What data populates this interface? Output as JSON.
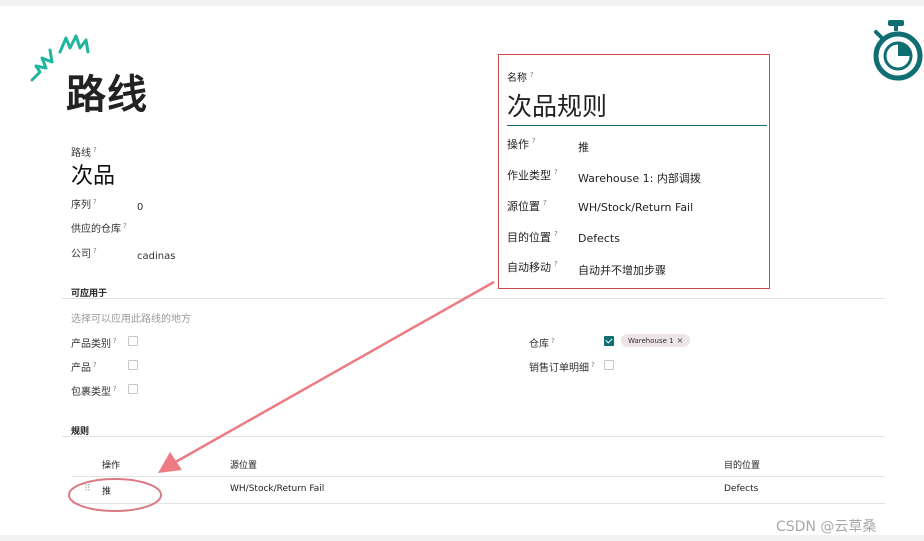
{
  "page_title": "路线",
  "route_field_label": "路线",
  "route_name": "次品",
  "fields": [
    {
      "label": "序列",
      "value": "0"
    },
    {
      "label": "供应的仓库",
      "value": ""
    },
    {
      "label": "公司",
      "value": "cadinas"
    }
  ],
  "applicable": {
    "heading": "可应用于",
    "placeholder": "选择可以应用此路线的地方",
    "left_options": [
      {
        "label": "产品类别",
        "checked": false
      },
      {
        "label": "产品",
        "checked": false
      },
      {
        "label": "包裹类型",
        "checked": false
      }
    ],
    "warehouse_label": "仓库",
    "warehouse_checked": true,
    "warehouse_tag": "Warehouse 1",
    "warehouse_tag_remove": "×",
    "sale_line_label": "销售订单明细",
    "sale_line_checked": false
  },
  "rules": {
    "heading": "规则",
    "columns": [
      "操作",
      "源位置",
      "目的位置"
    ],
    "rows": [
      {
        "handle": "⠿",
        "action": "推",
        "source": "WH/Stock/Return Fail",
        "dest": "Defects"
      }
    ]
  },
  "callout": {
    "name_label": "名称",
    "name_value": "次品规则",
    "rows": [
      {
        "label": "操作",
        "value": "推"
      },
      {
        "label": "作业类型",
        "value": "Warehouse 1: 内部调拨"
      },
      {
        "label": "源位置",
        "value": "WH/Stock/Return Fail"
      },
      {
        "label": "目的位置",
        "value": "Defects"
      },
      {
        "label": "自动移动",
        "value": "自动并不增加步骤"
      }
    ]
  },
  "help_mark": "?",
  "watermark": "CSDN @云草桑",
  "colors": {
    "accent": "#0f6e72",
    "callout_border": "#c94a4a",
    "arrow": "#ec7c82",
    "sparkle": "#1fb5a0"
  },
  "icons": {
    "top_right": "stopwatch-icon",
    "top_left": "sparkle-icon"
  }
}
